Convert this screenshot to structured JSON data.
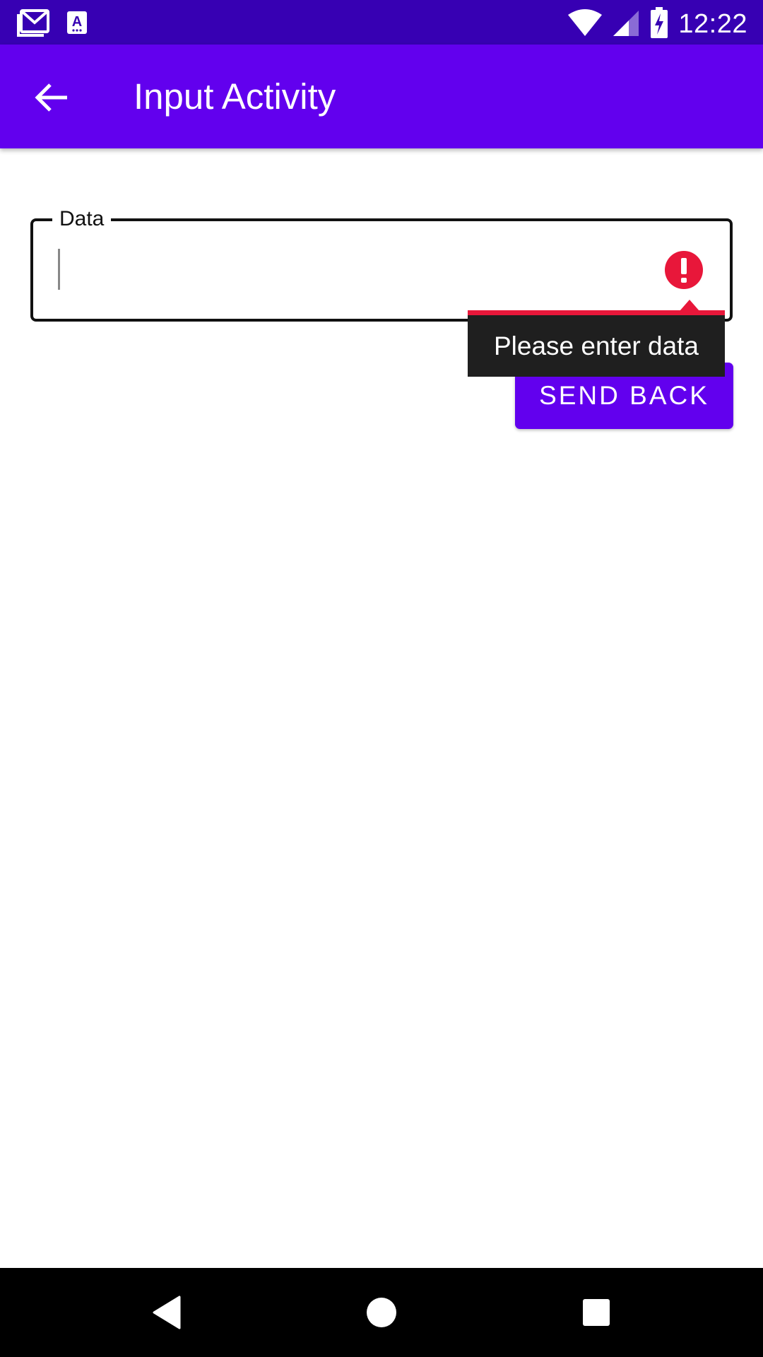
{
  "status_bar": {
    "time": "12:22",
    "left_icons": [
      "gmail-icon",
      "text-app-icon"
    ],
    "right_icons": [
      "wifi-icon",
      "cell-signal-icon",
      "battery-charging-icon"
    ],
    "background": "#3700B3"
  },
  "app_bar": {
    "title": "Input Activity",
    "back_icon": "arrow-back-icon",
    "background": "#6200EE"
  },
  "form": {
    "field_label": "Data",
    "field_value": "",
    "error_message": "Please enter data",
    "error_color": "#E8173A",
    "send_button_label": "SEND BACK"
  },
  "nav_bar": {
    "icons": [
      "nav-back-icon",
      "nav-home-icon",
      "nav-recents-icon"
    ]
  }
}
